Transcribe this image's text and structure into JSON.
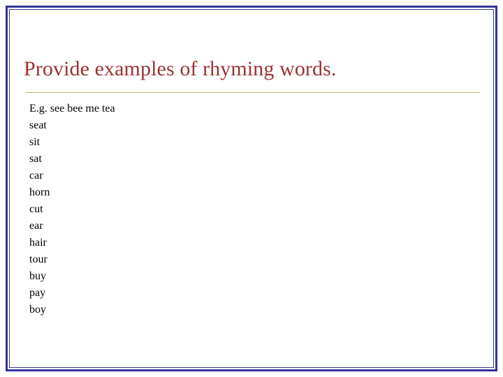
{
  "slide": {
    "title": "Provide examples of rhyming words.",
    "accent_title_color": "#993333",
    "border_color": "#333399",
    "rule_color": "#c9a96b",
    "body_lines": [
      "E.g. see bee me tea",
      "seat",
      "sit",
      "sat",
      "car",
      "horn",
      "cut",
      "ear",
      "hair",
      "tour",
      "buy",
      "pay",
      "boy"
    ]
  }
}
